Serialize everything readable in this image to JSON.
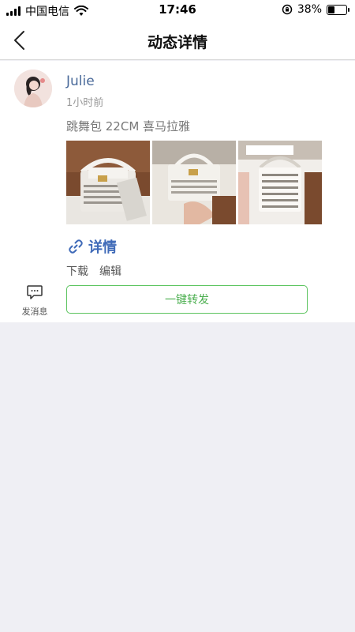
{
  "status_bar": {
    "carrier": "中国电信",
    "time": "17:46",
    "battery": "38%",
    "battery_level": 0.38
  },
  "nav": {
    "title": "动态详情",
    "back_icon": "chevron-left-icon"
  },
  "post": {
    "username": "Julie",
    "time_ago": "1小时前",
    "text": "跳舞包 22CM 喜马拉雅",
    "photo_count": 3,
    "link_label": "详情",
    "link_icon": "link-icon",
    "actions": {
      "download": "下载",
      "edit": "编辑"
    },
    "message_label": "发消息",
    "forward_label": "一键转发"
  },
  "colors": {
    "link_blue": "#3f6ab8",
    "username_blue": "#4a6a9a",
    "forward_green": "#4caf50",
    "page_bg": "#efeff4"
  }
}
